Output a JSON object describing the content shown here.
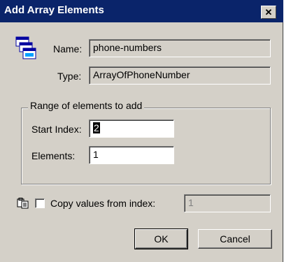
{
  "window": {
    "title": "Add Array Elements",
    "close_glyph": "✕"
  },
  "icons": {
    "app": "stacked-windows-icon",
    "copy": "copy-values-icon"
  },
  "name_field": {
    "label": "Name:",
    "value": "phone-numbers"
  },
  "type_field": {
    "label": "Type:",
    "value": "ArrayOfPhoneNumber"
  },
  "range_group": {
    "legend": "Range of elements to add",
    "start_index": {
      "label": "Start Index:",
      "value": "2"
    },
    "elements": {
      "label": "Elements:",
      "value": "1"
    }
  },
  "copy_option": {
    "label": "Copy values from index:",
    "checked": false,
    "value": "1"
  },
  "buttons": {
    "ok": "OK",
    "cancel": "Cancel"
  },
  "colors": {
    "titlebar": "#0a246a",
    "face": "#d4d0c8",
    "disabled_text": "#808080"
  }
}
